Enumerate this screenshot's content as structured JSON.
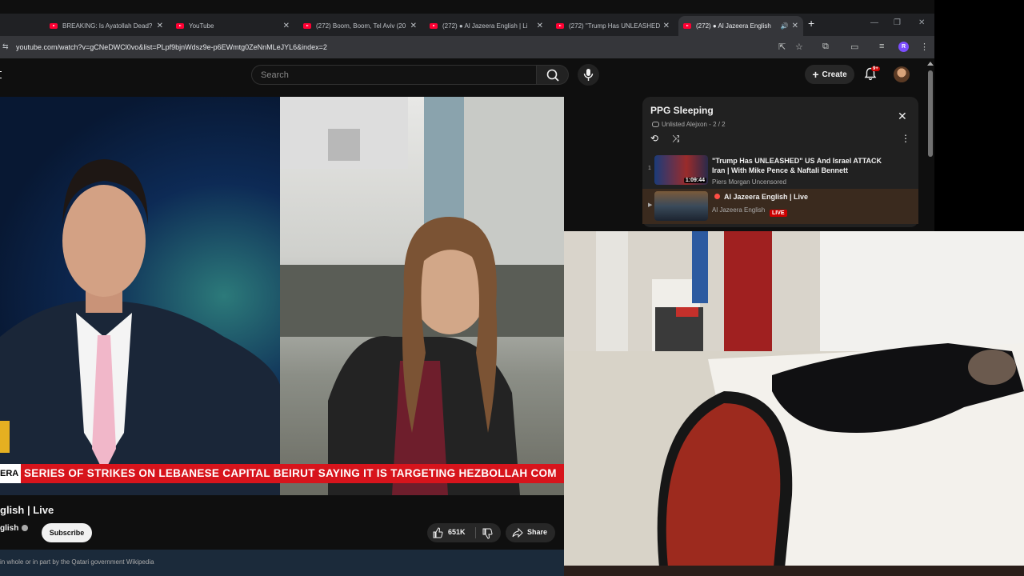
{
  "browser": {
    "tabs": [
      {
        "title": "BREAKING: Is Ayatollah Dead? –",
        "active": false
      },
      {
        "title": "YouTube",
        "active": false
      },
      {
        "title": "(272) Boom, Boom, Tel Aviv (20",
        "active": false
      },
      {
        "title": "(272) ● Al Jazeera English | Li",
        "active": false
      },
      {
        "title": "(272) \"Trump Has UNLEASHED\"",
        "active": false
      },
      {
        "title": "(272) ● Al Jazeera English",
        "active": true
      }
    ],
    "url": "youtube.com/watch?v=gCNeDWCl0vo&list=PLpf9bjnWdsz9e-p6EWmtg0ZeNnMLeJYL6&index=2",
    "profile_initial": "R"
  },
  "youtube": {
    "search_placeholder": "Search",
    "create_label": "Create",
    "notification_badge": "9+"
  },
  "video": {
    "ticker_tag": "ERA",
    "ticker_text": "SERIES OF STRIKES ON LEBANESE CAPITAL BEIRUT SAYING IT IS TARGETING HEZBOLLAH COM",
    "title": "glish | Live",
    "channel": "glish",
    "subscribe_label": "Subscribe",
    "like_count": "651K",
    "share_label": "Share",
    "description_snippet": "in whole or in part by the Qatari government  Wikipedia"
  },
  "playlist": {
    "title": "PPG Sleeping",
    "visibility": "Unlisted",
    "owner": "Alejxon",
    "position": "2 / 2",
    "items": [
      {
        "index": "1",
        "title": "\"Trump Has UNLEASHED\" US And Israel ATTACK Iran | With Mike Pence & Naftali Bennett",
        "channel": "Piers Morgan Uncensored",
        "duration": "1:09:44"
      },
      {
        "index": "▶",
        "title": "Al Jazeera English | Live",
        "channel": "Al Jazeera English",
        "live_label": "LIVE"
      }
    ]
  },
  "colors": {
    "yt_red": "#ff0033",
    "ticker_red": "#d7141c",
    "live_red": "#cc0000"
  }
}
